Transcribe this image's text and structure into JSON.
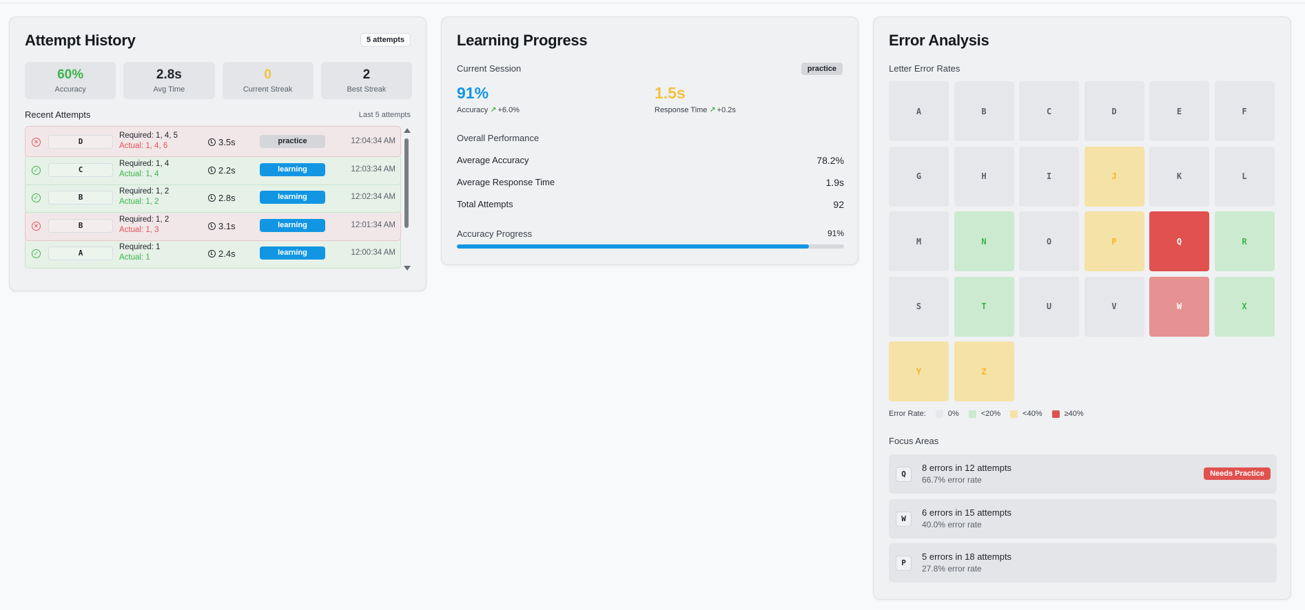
{
  "history": {
    "title": "Attempt History",
    "count_badge": "5 attempts",
    "stats": [
      {
        "value": "60%",
        "label": "Accuracy",
        "color": "#3cb44b"
      },
      {
        "value": "2.8s",
        "label": "Avg Time",
        "color": "#1f2329"
      },
      {
        "value": "0",
        "label": "Current Streak",
        "color": "#f3c23f"
      },
      {
        "value": "2",
        "label": "Best Streak",
        "color": "#1f2329"
      }
    ],
    "recent_label": "Recent Attempts",
    "recent_right": "Last 5 attempts",
    "attempts": [
      {
        "status": "fail",
        "icon": "x-circle-icon",
        "letter": "D",
        "required": "Required: 1, 4, 5",
        "actual": "Actual: 1, 4, 6",
        "duration": "3.5s",
        "mode": "practice",
        "time": "12:04:34 AM"
      },
      {
        "status": "ok",
        "icon": "check-circle-icon",
        "letter": "C",
        "required": "Required: 1, 4",
        "actual": "Actual: 1, 4",
        "duration": "2.2s",
        "mode": "learning",
        "time": "12:03:34 AM"
      },
      {
        "status": "ok",
        "icon": "check-circle-icon",
        "letter": "B",
        "required": "Required: 1, 2",
        "actual": "Actual: 1, 2",
        "duration": "2.8s",
        "mode": "learning",
        "time": "12:02:34 AM"
      },
      {
        "status": "fail",
        "icon": "x-circle-icon",
        "letter": "B",
        "required": "Required: 1, 2",
        "actual": "Actual: 1, 3",
        "duration": "3.1s",
        "mode": "learning",
        "time": "12:01:34 AM"
      },
      {
        "status": "ok",
        "icon": "check-circle-icon",
        "letter": "A",
        "required": "Required: 1",
        "actual": "Actual: 1",
        "duration": "2.4s",
        "mode": "learning",
        "time": "12:00:34 AM"
      }
    ]
  },
  "progress": {
    "title": "Learning Progress",
    "session_label": "Current Session",
    "session_badge": "practice",
    "accuracy": {
      "value": "91%",
      "label": "Accuracy",
      "trend": "+6.0%",
      "color": "#1296e3"
    },
    "response": {
      "value": "1.5s",
      "label": "Response Time",
      "trend": "+0.2s",
      "color": "#f3c23f"
    },
    "overall_label": "Overall Performance",
    "rows": [
      {
        "label": "Average Accuracy",
        "value": "78.2%"
      },
      {
        "label": "Average Response Time",
        "value": "1.9s"
      },
      {
        "label": "Total Attempts",
        "value": "92"
      }
    ],
    "bar_label": "Accuracy Progress",
    "bar_value": "91%",
    "bar_fraction": 0.91
  },
  "errors": {
    "title": "Error Analysis",
    "rates_label": "Letter Error Rates",
    "letters": [
      {
        "l": "A",
        "lvl": 0
      },
      {
        "l": "B",
        "lvl": 0
      },
      {
        "l": "C",
        "lvl": 0
      },
      {
        "l": "D",
        "lvl": 0
      },
      {
        "l": "E",
        "lvl": 0
      },
      {
        "l": "F",
        "lvl": 0
      },
      {
        "l": "G",
        "lvl": 0
      },
      {
        "l": "H",
        "lvl": 0
      },
      {
        "l": "I",
        "lvl": 0
      },
      {
        "l": "J",
        "lvl": 2
      },
      {
        "l": "K",
        "lvl": 0
      },
      {
        "l": "L",
        "lvl": 0
      },
      {
        "l": "M",
        "lvl": 0
      },
      {
        "l": "N",
        "lvl": 1
      },
      {
        "l": "O",
        "lvl": 0
      },
      {
        "l": "P",
        "lvl": 2
      },
      {
        "l": "Q",
        "lvl": 3
      },
      {
        "l": "R",
        "lvl": 1
      },
      {
        "l": "S",
        "lvl": 0
      },
      {
        "l": "T",
        "lvl": 1
      },
      {
        "l": "U",
        "lvl": 0
      },
      {
        "l": "V",
        "lvl": 0
      },
      {
        "l": "W",
        "lvl": 4
      },
      {
        "l": "X",
        "lvl": 1
      },
      {
        "l": "Y",
        "lvl": 2
      },
      {
        "l": "Z",
        "lvl": 2
      }
    ],
    "legend_title": "Error Rate:",
    "legend": [
      {
        "label": "0%",
        "color": "#e6e7ea"
      },
      {
        "label": "<20%",
        "color": "#cbeacf"
      },
      {
        "label": "<40%",
        "color": "#f5e2a6"
      },
      {
        "label": "≥40%",
        "color": "#e0514f"
      }
    ],
    "focus_label": "Focus Areas",
    "focus": [
      {
        "letter": "Q",
        "main": "8 errors in 12 attempts",
        "sub": "66.7% error rate",
        "badge": "Needs Practice"
      },
      {
        "letter": "W",
        "main": "6 errors in 15 attempts",
        "sub": "40.0% error rate",
        "badge": ""
      },
      {
        "letter": "P",
        "main": "5 errors in 18 attempts",
        "sub": "27.8% error rate",
        "badge": ""
      }
    ]
  }
}
